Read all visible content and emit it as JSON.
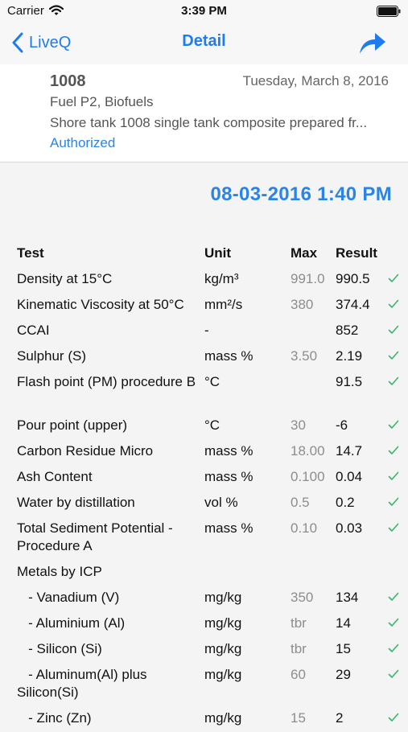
{
  "status_bar": {
    "carrier": "Carrier",
    "time": "3:39 PM"
  },
  "nav": {
    "back_label": "LiveQ",
    "title": "Detail"
  },
  "sample": {
    "id": "1008",
    "date": "Tuesday, March 8, 2016",
    "product": "Fuel P2, Biofuels",
    "description": "Shore tank 1008  single tank composite prepared fr...",
    "status": "Authorized"
  },
  "result_datetime": "08-03-2016  1:40 PM",
  "table": {
    "headers": {
      "test": "Test",
      "unit": "Unit",
      "max": "Max",
      "result": "Result"
    },
    "rows": [
      {
        "test": "Density at 15°C",
        "unit": "kg/m³",
        "max": "991.0",
        "result": "990.5",
        "check": true
      },
      {
        "test": "Kinematic Viscosity at 50°C",
        "unit": "mm²/s",
        "max": "380",
        "result": "374.4",
        "check": true
      },
      {
        "test": "CCAI",
        "unit": "-",
        "max": "",
        "result": "852",
        "check": true
      },
      {
        "test": "Sulphur (S)",
        "unit": "mass %",
        "max": "3.50",
        "result": "2.19",
        "check": true
      },
      {
        "test": "Flash point (PM) procedure B",
        "unit": "°C",
        "max": "",
        "result": "91.5",
        "check": true
      },
      {
        "test": "Pour point (upper)",
        "unit": "°C",
        "max": "30",
        "result": "-6",
        "check": true
      },
      {
        "test": "Carbon Residue Micro",
        "unit": "mass %",
        "max": "18.00",
        "result": "14.7",
        "check": true
      },
      {
        "test": "Ash Content",
        "unit": "mass %",
        "max": "0.100",
        "result": "0.04",
        "check": true
      },
      {
        "test": "Water by distillation",
        "unit": "vol %",
        "max": "0.5",
        "result": "0.2",
        "check": true
      },
      {
        "test": "Total Sediment Potential - Procedure A",
        "unit": "mass %",
        "max": "0.10",
        "result": "0.03",
        "check": true
      },
      {
        "test": "Metals by ICP",
        "unit": "",
        "max": "",
        "result": "",
        "check": false
      },
      {
        "test": "   - Vanadium (V)",
        "unit": "mg/kg",
        "max": "350",
        "result": "134",
        "check": true
      },
      {
        "test": "   - Aluminium (Al)",
        "unit": "mg/kg",
        "max": "tbr",
        "result": "14",
        "check": true
      },
      {
        "test": "   - Silicon (Si)",
        "unit": "mg/kg",
        "max": "tbr",
        "result": "15",
        "check": true
      },
      {
        "test": "   - Aluminum(Al) plus Silicon(Si)",
        "unit": "mg/kg",
        "max": "60",
        "result": "29",
        "check": true
      },
      {
        "test": "   - Zinc (Zn)",
        "unit": "mg/kg",
        "max": "15",
        "result": "2",
        "check": true
      }
    ]
  }
}
